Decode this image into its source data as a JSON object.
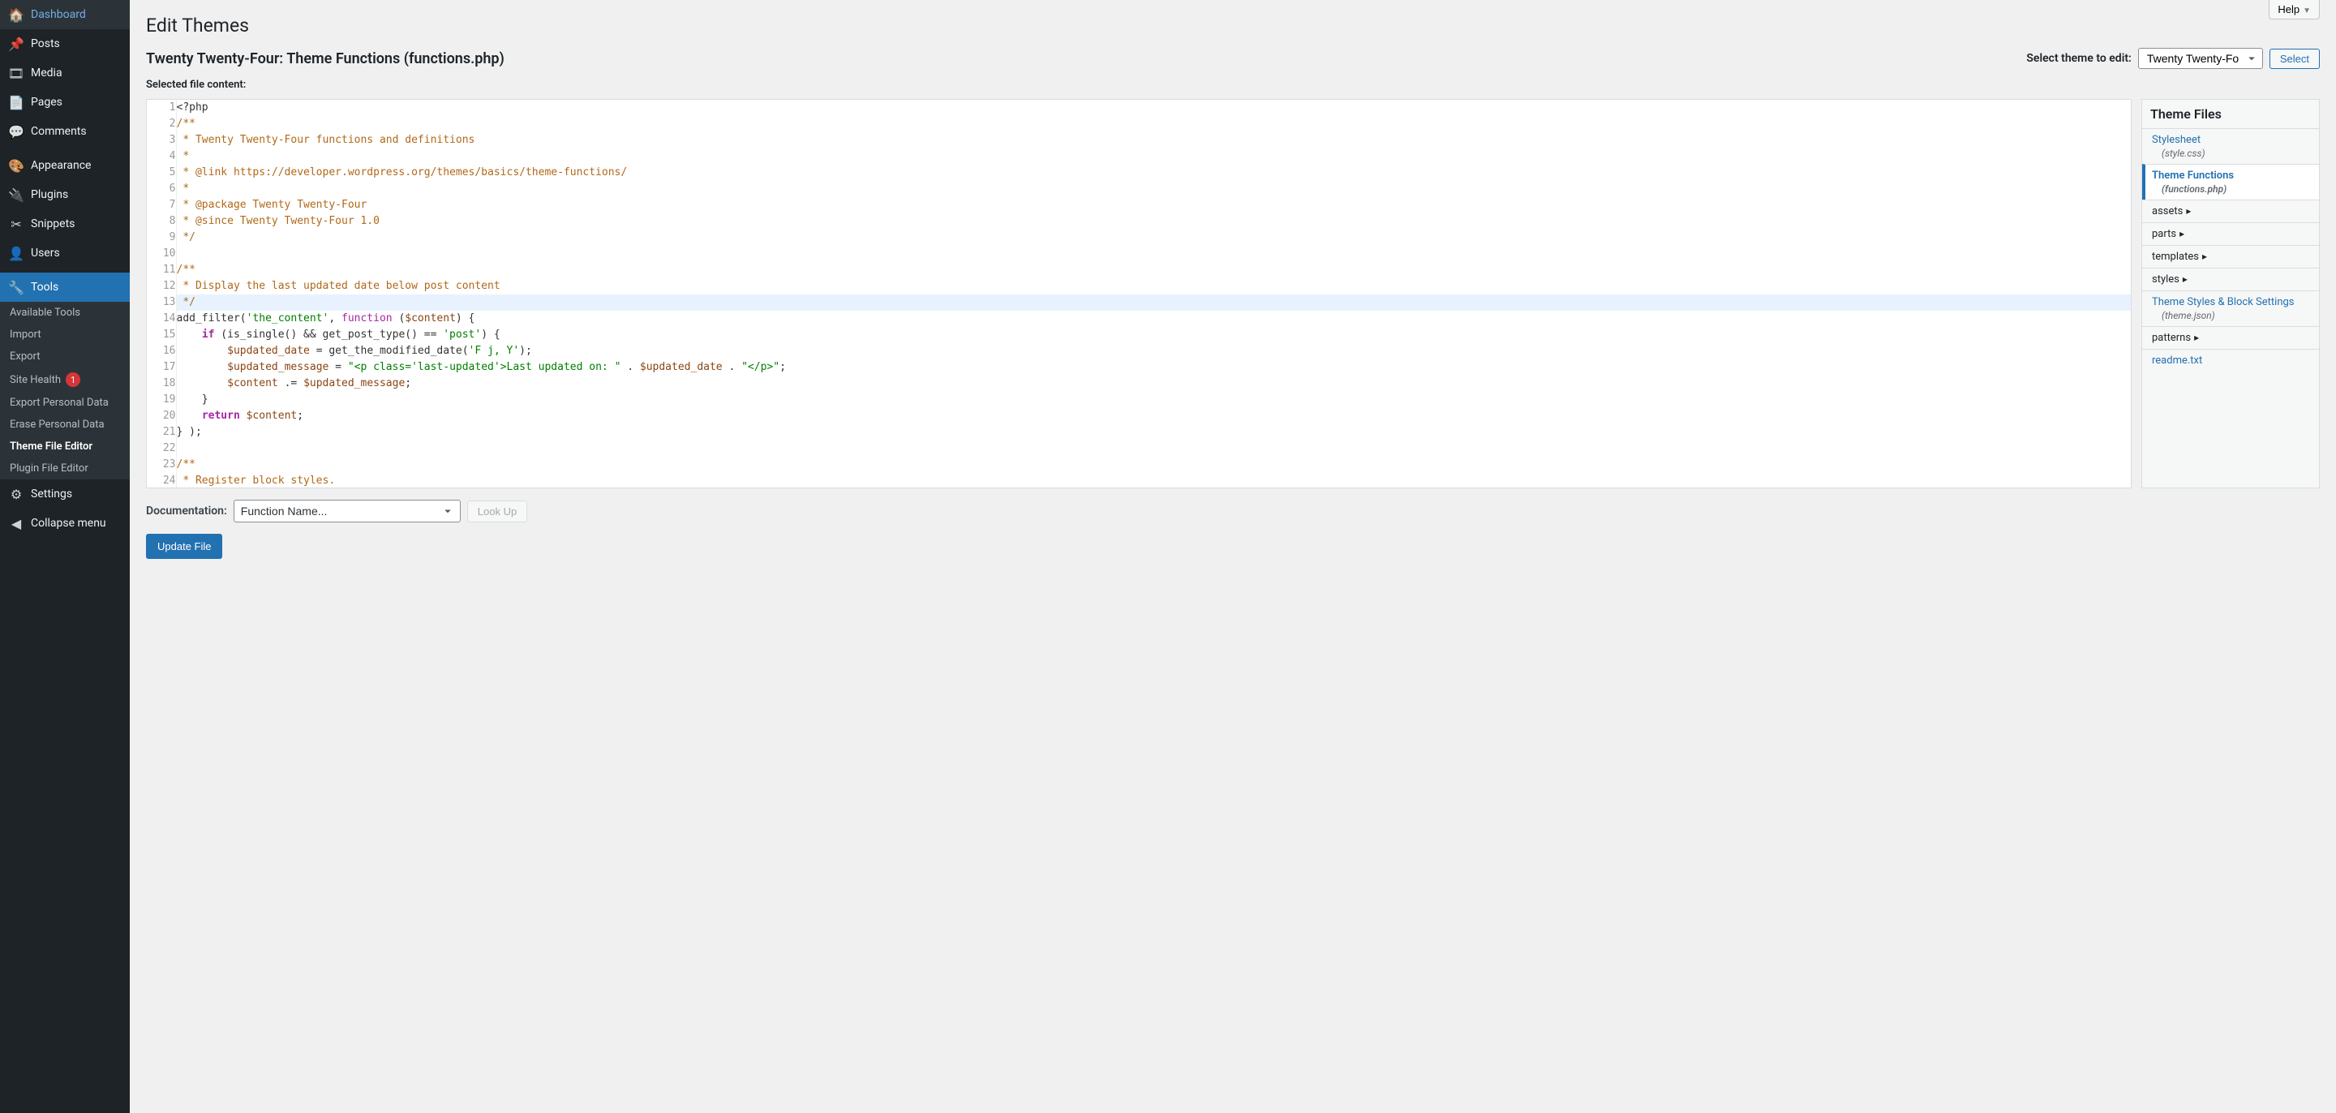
{
  "sidebar": {
    "items": [
      {
        "icon": "🏠",
        "label": "Dashboard"
      },
      {
        "icon": "📌",
        "label": "Posts"
      },
      {
        "icon": "🎞",
        "label": "Media"
      },
      {
        "icon": "📄",
        "label": "Pages"
      },
      {
        "icon": "💬",
        "label": "Comments"
      },
      {
        "icon": "🎨",
        "label": "Appearance"
      },
      {
        "icon": "🔌",
        "label": "Plugins"
      },
      {
        "icon": "✂",
        "label": "Snippets"
      },
      {
        "icon": "👤",
        "label": "Users"
      },
      {
        "icon": "🔧",
        "label": "Tools"
      }
    ],
    "active_index": 9,
    "sub_items": [
      {
        "label": "Available Tools"
      },
      {
        "label": "Import"
      },
      {
        "label": "Export"
      },
      {
        "label": "Site Health",
        "badge": "1"
      },
      {
        "label": "Export Personal Data"
      },
      {
        "label": "Erase Personal Data"
      },
      {
        "label": "Theme File Editor",
        "active": true
      },
      {
        "label": "Plugin File Editor"
      }
    ],
    "footer": [
      {
        "icon": "⚙",
        "label": "Settings"
      },
      {
        "icon": "◀",
        "label": "Collapse menu"
      }
    ]
  },
  "help_label": "Help",
  "page_title": "Edit Themes",
  "file_title": "Twenty Twenty-Four: Theme Functions (functions.php)",
  "theme_select_label": "Select theme to edit:",
  "theme_select_value": "Twenty Twenty-Fo",
  "select_btn": "Select",
  "content_label": "Selected file content:",
  "code_lines": [
    [
      {
        "t": "<?php",
        "c": "tok-default"
      }
    ],
    [
      {
        "t": "/**",
        "c": "tok-comment"
      }
    ],
    [
      {
        "t": " * Twenty Twenty-Four functions and definitions",
        "c": "tok-comment"
      }
    ],
    [
      {
        "t": " *",
        "c": "tok-comment"
      }
    ],
    [
      {
        "t": " * @link https://developer.wordpress.org/themes/basics/theme-functions/",
        "c": "tok-comment"
      }
    ],
    [
      {
        "t": " *",
        "c": "tok-comment"
      }
    ],
    [
      {
        "t": " * @package Twenty Twenty-Four",
        "c": "tok-comment"
      }
    ],
    [
      {
        "t": " * @since Twenty Twenty-Four 1.0",
        "c": "tok-comment"
      }
    ],
    [
      {
        "t": " */",
        "c": "tok-comment"
      }
    ],
    [
      {
        "t": "",
        "c": "tok-default"
      }
    ],
    [
      {
        "t": "/**",
        "c": "tok-comment"
      }
    ],
    [
      {
        "t": " * Display the last updated date below post content",
        "c": "tok-comment"
      }
    ],
    [
      {
        "t": " */",
        "c": "tok-comment"
      }
    ],
    [
      {
        "t": "add_filter(",
        "c": "tok-default"
      },
      {
        "t": "'the_content'",
        "c": "tok-string"
      },
      {
        "t": ", ",
        "c": "tok-default"
      },
      {
        "t": "function",
        "c": "tok-func"
      },
      {
        "t": " (",
        "c": "tok-default"
      },
      {
        "t": "$content",
        "c": "tok-var"
      },
      {
        "t": ") {",
        "c": "tok-default"
      }
    ],
    [
      {
        "t": "    ",
        "c": "tok-default"
      },
      {
        "t": "if",
        "c": "tok-keyword"
      },
      {
        "t": " (is_single() && get_post_type() == ",
        "c": "tok-default"
      },
      {
        "t": "'post'",
        "c": "tok-string"
      },
      {
        "t": ") {",
        "c": "tok-default"
      }
    ],
    [
      {
        "t": "        ",
        "c": "tok-default"
      },
      {
        "t": "$updated_date",
        "c": "tok-var"
      },
      {
        "t": " = get_the_modified_date(",
        "c": "tok-default"
      },
      {
        "t": "'F j, Y'",
        "c": "tok-string"
      },
      {
        "t": ");",
        "c": "tok-default"
      }
    ],
    [
      {
        "t": "        ",
        "c": "tok-default"
      },
      {
        "t": "$updated_message",
        "c": "tok-var"
      },
      {
        "t": " = ",
        "c": "tok-default"
      },
      {
        "t": "\"<p class='last-updated'>Last updated on: \"",
        "c": "tok-string"
      },
      {
        "t": " . ",
        "c": "tok-default"
      },
      {
        "t": "$updated_date",
        "c": "tok-var"
      },
      {
        "t": " . ",
        "c": "tok-default"
      },
      {
        "t": "\"</p>\"",
        "c": "tok-string"
      },
      {
        "t": ";",
        "c": "tok-default"
      }
    ],
    [
      {
        "t": "        ",
        "c": "tok-default"
      },
      {
        "t": "$content",
        "c": "tok-var"
      },
      {
        "t": " .= ",
        "c": "tok-default"
      },
      {
        "t": "$updated_message",
        "c": "tok-var"
      },
      {
        "t": ";",
        "c": "tok-default"
      }
    ],
    [
      {
        "t": "    }",
        "c": "tok-default"
      }
    ],
    [
      {
        "t": "    ",
        "c": "tok-default"
      },
      {
        "t": "return",
        "c": "tok-keyword"
      },
      {
        "t": " ",
        "c": "tok-default"
      },
      {
        "t": "$content",
        "c": "tok-var"
      },
      {
        "t": ";",
        "c": "tok-default"
      }
    ],
    [
      {
        "t": "} );",
        "c": "tok-default"
      }
    ],
    [
      {
        "t": "",
        "c": "tok-default"
      }
    ],
    [
      {
        "t": "/**",
        "c": "tok-comment"
      }
    ],
    [
      {
        "t": " * Register block styles.",
        "c": "tok-comment"
      }
    ],
    [
      {
        "t": " */",
        "c": "tok-comment"
      }
    ]
  ],
  "highlight_line": 13,
  "file_tree": {
    "title": "Theme Files",
    "items": [
      {
        "label": "Stylesheet",
        "sub": "(style.css)",
        "link": true
      },
      {
        "label": "Theme Functions",
        "sub": "(functions.php)",
        "active": true
      },
      {
        "label": "assets",
        "folder": true
      },
      {
        "label": "parts",
        "folder": true
      },
      {
        "label": "templates",
        "folder": true
      },
      {
        "label": "styles",
        "folder": true
      },
      {
        "label": "Theme Styles & Block Settings",
        "sub": "(theme.json)",
        "link": true
      },
      {
        "label": "patterns",
        "folder": true
      },
      {
        "label": "readme.txt",
        "link": true
      }
    ]
  },
  "doc_label": "Documentation:",
  "doc_placeholder": "Function Name...",
  "lookup_btn": "Look Up",
  "update_btn": "Update File"
}
